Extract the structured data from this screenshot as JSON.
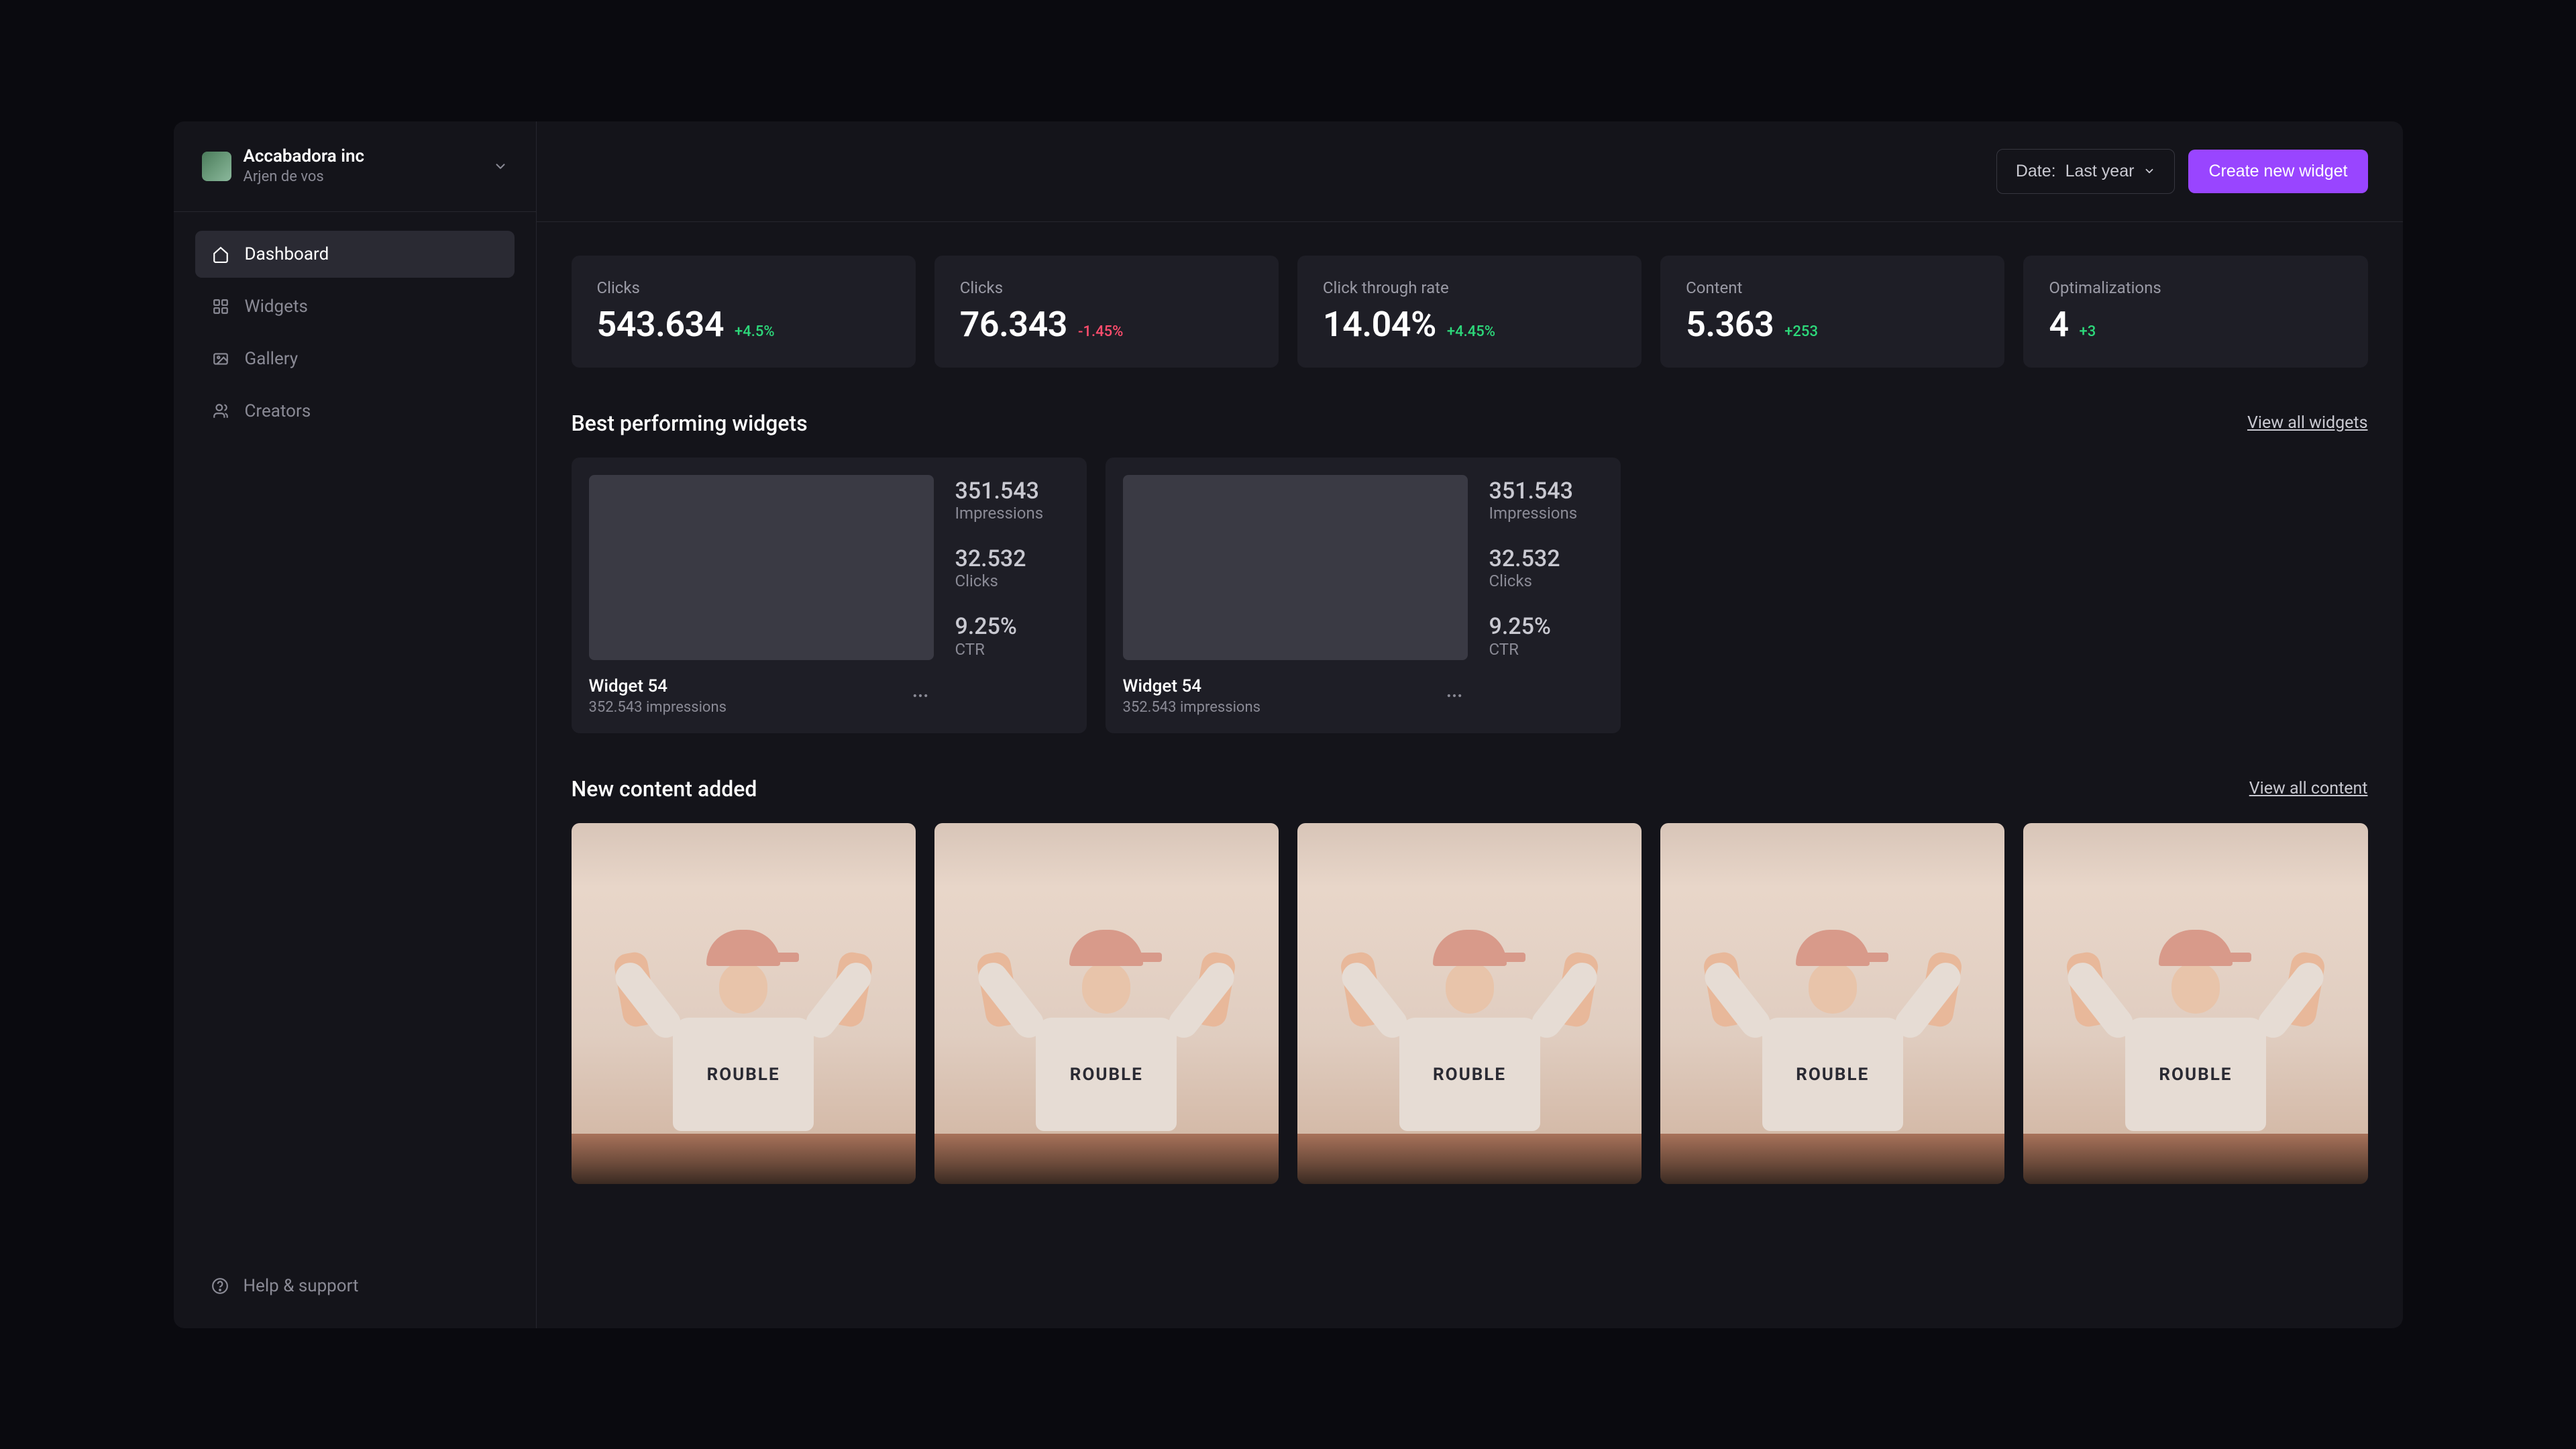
{
  "org": {
    "name": "Accabadora inc",
    "user": "Arjen de vos"
  },
  "nav": {
    "items": [
      {
        "label": "Dashboard"
      },
      {
        "label": "Widgets"
      },
      {
        "label": "Gallery"
      },
      {
        "label": "Creators"
      }
    ],
    "help_label": "Help & support"
  },
  "topbar": {
    "date_prefix": "Date: ",
    "date_value": "Last year",
    "create_label": "Create new widget"
  },
  "stats": [
    {
      "label": "Clicks",
      "value": "543.634",
      "delta": "+4.5%",
      "delta_class": "delta-pos"
    },
    {
      "label": "Clicks",
      "value": "76.343",
      "delta": "-1.45%",
      "delta_class": "delta-neg"
    },
    {
      "label": "Click through rate",
      "value": "14.04%",
      "delta": "+4.45%",
      "delta_class": "delta-pos"
    },
    {
      "label": "Content",
      "value": "5.363",
      "delta": "+253",
      "delta_class": "delta-pos"
    },
    {
      "label": "Optimalizations",
      "value": "4",
      "delta": "+3",
      "delta_class": "delta-pos"
    }
  ],
  "widgets_section": {
    "title": "Best performing widgets",
    "view_all": "View all widgets",
    "cards": [
      {
        "name": "Widget 54",
        "sub": "352.543 impressions",
        "impressions_value": "351.543",
        "impressions_label": "Impressions",
        "clicks_value": "32.532",
        "clicks_label": "Clicks",
        "ctr_value": "9.25%",
        "ctr_label": "CTR"
      },
      {
        "name": "Widget 54",
        "sub": "352.543 impressions",
        "impressions_value": "351.543",
        "impressions_label": "Impressions",
        "clicks_value": "32.532",
        "clicks_label": "Clicks",
        "ctr_value": "9.25%",
        "ctr_label": "CTR"
      }
    ]
  },
  "content_section": {
    "title": "New content added",
    "view_all": "View all content",
    "hoodie_text": "ROUBLE"
  }
}
